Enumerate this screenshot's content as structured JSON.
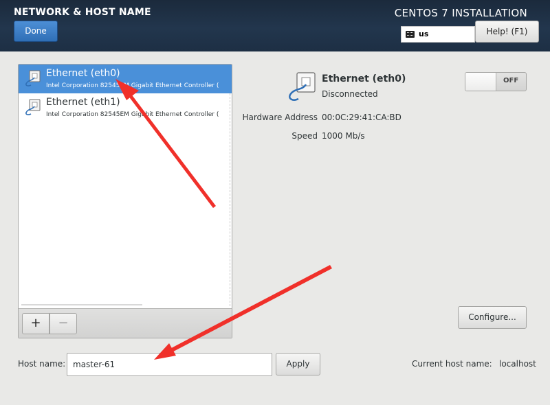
{
  "header": {
    "spoke_title": "NETWORK & HOST NAME",
    "done_label": "Done",
    "product_title": "CENTOS 7 INSTALLATION",
    "keyboard_layout": "us",
    "help_label": "Help! (F1)"
  },
  "devices": [
    {
      "name": "Ethernet (eth0)",
      "description": "Intel Corporation 82545EM Gigabit Ethernet Controller (",
      "selected": true
    },
    {
      "name": "Ethernet (eth1)",
      "description": "Intel Corporation 82545EM Gigabit Ethernet Controller (",
      "selected": false
    }
  ],
  "list_toolbar": {
    "add_label": "+",
    "remove_label": "−"
  },
  "detail": {
    "name": "Ethernet (eth0)",
    "status": "Disconnected",
    "toggle_label": "OFF",
    "toggle_on": false,
    "hardware_address_label": "Hardware Address",
    "hardware_address": "00:0C:29:41:CA:BD",
    "speed_label": "Speed",
    "speed": "1000 Mb/s",
    "configure_label": "Configure..."
  },
  "hostname": {
    "label": "Host name:",
    "value": "master-61",
    "apply_label": "Apply",
    "current_label": "Current host name:",
    "current_value": "localhost"
  },
  "colors": {
    "selection": "#4a90d9",
    "header_bg": "#1b2a3c",
    "annotation_arrow": "#f0302a"
  },
  "icons": {
    "device": "ethernet-cable-icon",
    "keyboard": "keyboard-icon"
  }
}
